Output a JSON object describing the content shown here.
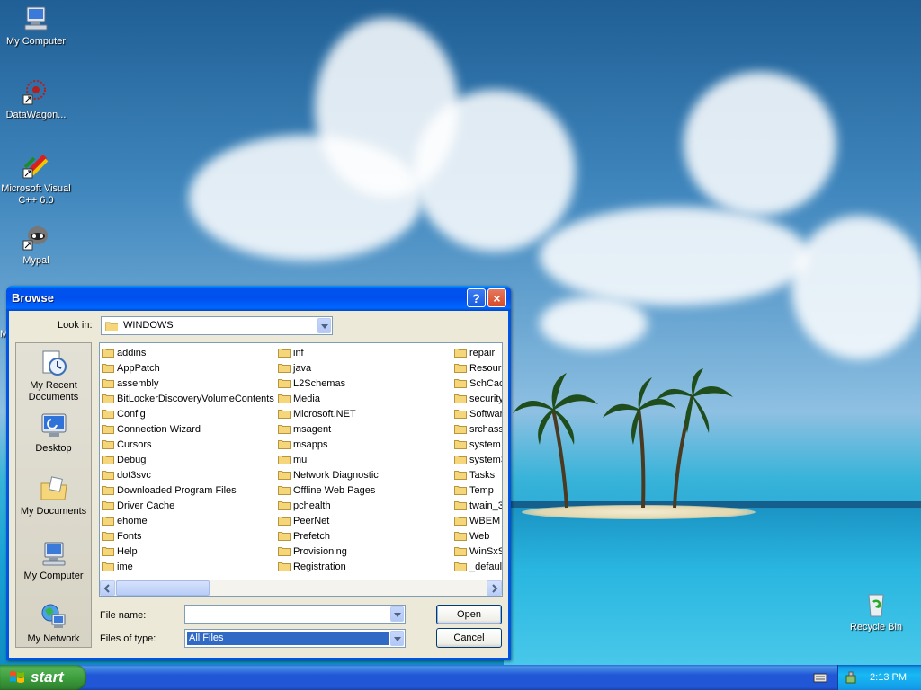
{
  "desktop": {
    "icons": [
      {
        "label": "My Computer",
        "icon": "my-computer-icon"
      },
      {
        "label": "DataWagon...",
        "icon": "datawagon-icon"
      },
      {
        "label": "Microsoft Visual C++ 6.0",
        "icon": "visual-cpp-icon"
      },
      {
        "label": "Mypal",
        "icon": "mypal-icon"
      },
      {
        "label": "Recycle Bin",
        "icon": "recycle-bin-icon"
      }
    ],
    "partial_letter": "M"
  },
  "dialog": {
    "title": "Browse",
    "help_label": "?",
    "close_label": "×",
    "look_in_label": "Look in:",
    "look_in_value": "WINDOWS",
    "places": [
      {
        "label": "My Recent Documents",
        "icon": "recent-documents-icon"
      },
      {
        "label": "Desktop",
        "icon": "desktop-icon"
      },
      {
        "label": "My Documents",
        "icon": "my-documents-icon"
      },
      {
        "label": "My Computer",
        "icon": "my-computer-icon"
      },
      {
        "label": "My Network",
        "icon": "my-network-icon"
      }
    ],
    "columns": [
      [
        "addins",
        "AppPatch",
        "assembly",
        "BitLockerDiscoveryVolumeContents",
        "Config",
        "Connection Wizard",
        "Cursors",
        "Debug",
        "dot3svc",
        "Downloaded Program Files",
        "Driver Cache",
        "ehome",
        "Fonts",
        "Help",
        "ime"
      ],
      [
        "inf",
        "java",
        "L2Schemas",
        "Media",
        "Microsoft.NET",
        "msagent",
        "msapps",
        "mui",
        "Network Diagnostic",
        "Offline Web Pages",
        "pchealth",
        "PeerNet",
        "Prefetch",
        "Provisioning",
        "Registration"
      ],
      [
        "repair",
        "Resourc",
        "SchCach",
        "security",
        "Softwar",
        "srchass",
        "system",
        "system3",
        "Tasks",
        "Temp",
        "twain_3",
        "WBEM",
        "Web",
        "WinSxS",
        "_defaul"
      ]
    ],
    "file_name_label": "File name:",
    "file_name_value": "",
    "files_of_type_label": "Files of type:",
    "files_of_type_value": "All Files",
    "open_label": "Open",
    "cancel_label": "Cancel"
  },
  "taskbar": {
    "start_label": "start",
    "clock": "2:13 PM"
  },
  "colors": {
    "titlebar": "#0054e3",
    "selection": "#316ac5",
    "start_green": "#3a993a"
  }
}
